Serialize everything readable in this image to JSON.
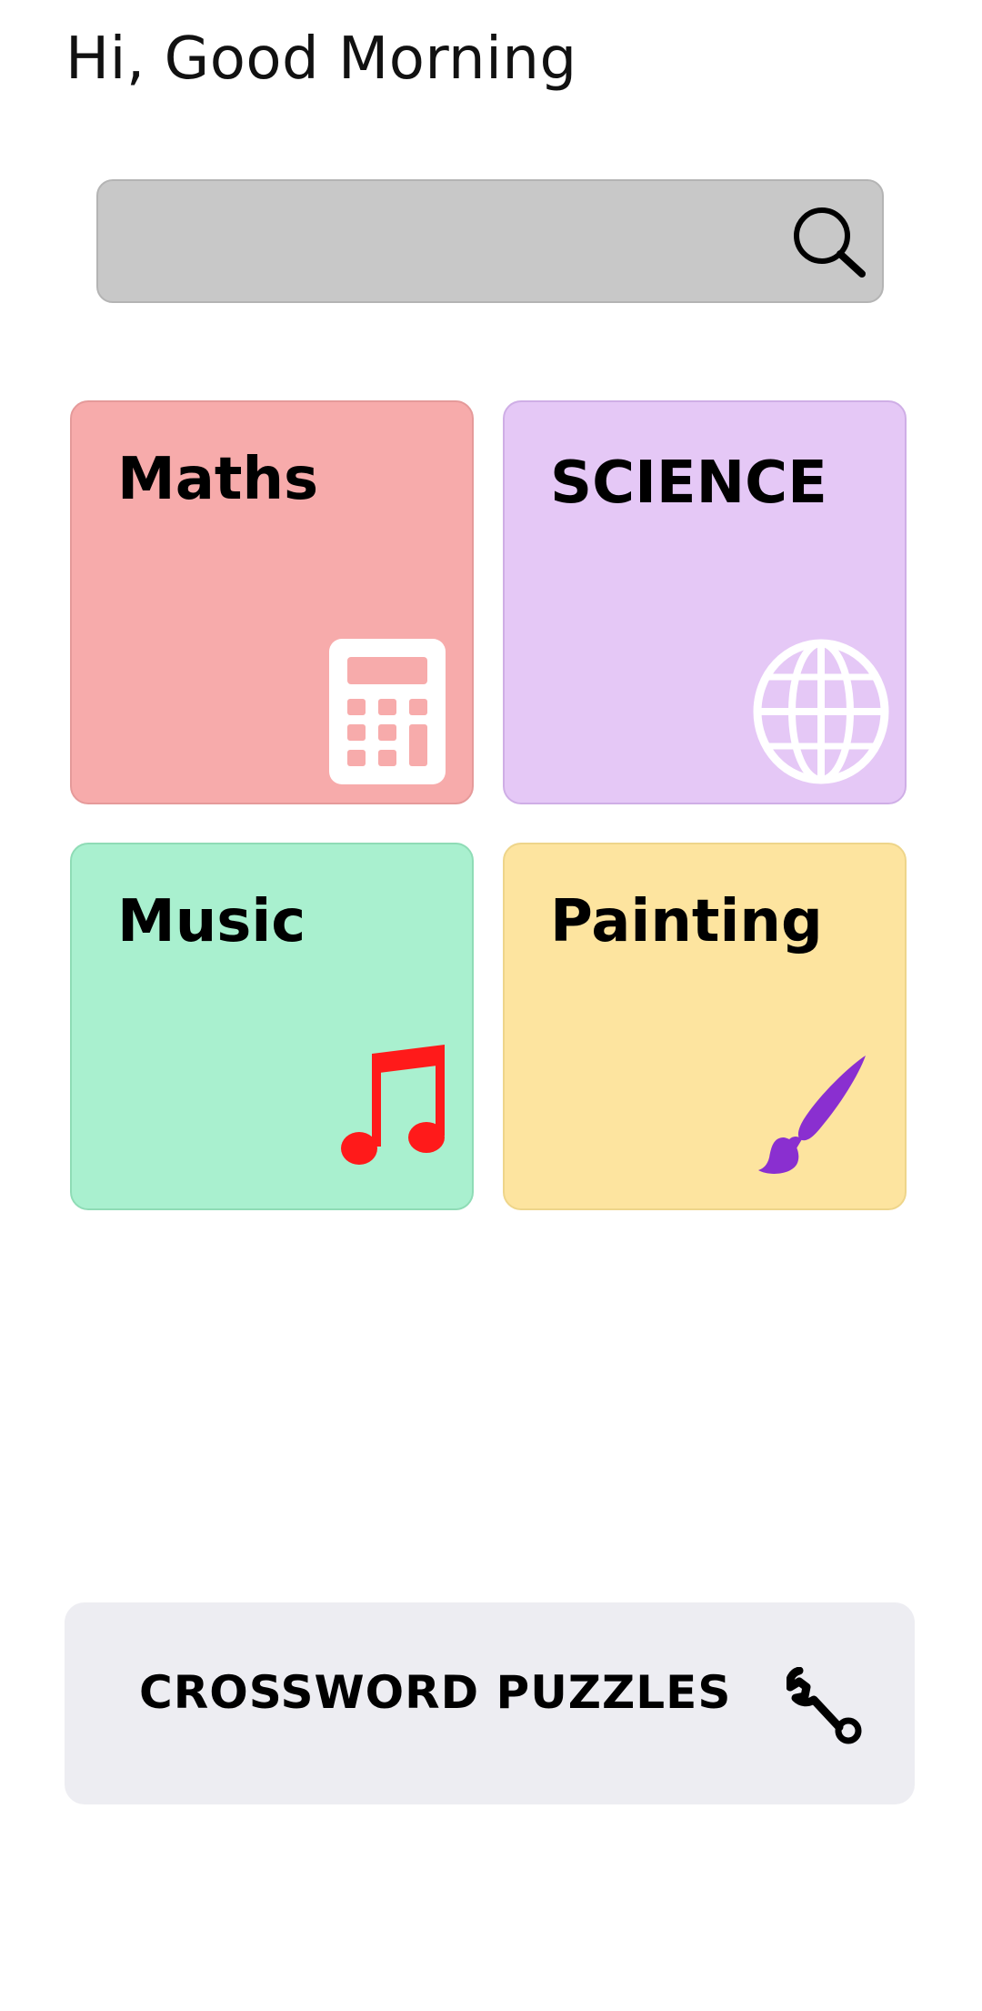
{
  "header": {
    "greeting": "Hi, Good Morning"
  },
  "search": {
    "value": "",
    "placeholder": "",
    "icon": "search-icon"
  },
  "categories": [
    {
      "label": "Maths",
      "icon": "calculator-icon",
      "color": "#f7abab",
      "icon_color": "#ffffff"
    },
    {
      "label": "SCIENCE",
      "icon": "globe-icon",
      "color": "#e5c8f6",
      "icon_color": "#ffffff"
    },
    {
      "label": "Music",
      "icon": "music-note-icon",
      "color": "#a9f0cf",
      "icon_color": "#ff1a1a"
    },
    {
      "label": "Painting",
      "icon": "paintbrush-icon",
      "color": "#fde49f",
      "icon_color": "#8a2fd0"
    }
  ],
  "crossword": {
    "label": "CROSSWORD PUZZLES",
    "icon": "wrench-icon",
    "color": "#ededf2"
  }
}
